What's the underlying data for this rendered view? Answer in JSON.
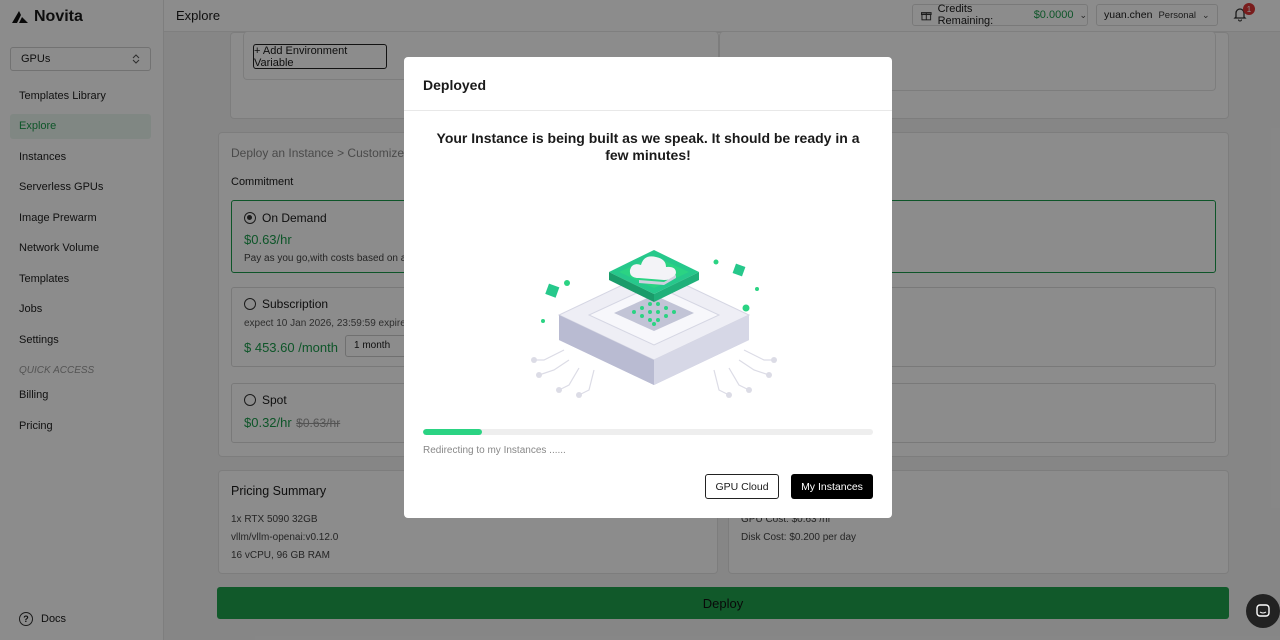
{
  "brand": {
    "name": "Novita"
  },
  "sidebar": {
    "gpu_select": "GPUs",
    "items": [
      {
        "label": "Templates Library"
      },
      {
        "label": "Explore",
        "active": true
      },
      {
        "label": "Instances"
      },
      {
        "label": "Serverless GPUs"
      },
      {
        "label": "Image Prewarm"
      },
      {
        "label": "Network Volume"
      },
      {
        "label": "Templates"
      },
      {
        "label": "Jobs"
      },
      {
        "label": "Settings"
      }
    ],
    "quick_access_label": "QUICK ACCESS",
    "quick_items": [
      {
        "label": "Billing"
      },
      {
        "label": "Pricing"
      }
    ],
    "docs_label": "Docs"
  },
  "header": {
    "title": "Explore",
    "credits_label": "Credits Remaining:",
    "credits_value": "$0.0000",
    "username": "yuan.chen",
    "plan": "Personal",
    "notification_count": "1"
  },
  "main": {
    "env_button": "+ Add Environment Variable",
    "breadcrumb": "Deploy an Instance > Customize",
    "commitment_label": "Commitment",
    "options": [
      {
        "title": "On Demand",
        "price": "$0.63/hr",
        "desc": "Pay as you go,with costs based on act"
      },
      {
        "title": "Subscription",
        "expire": "expect  10 Jan 2026, 23:59:59 expire",
        "price": "$ 453.60 /month",
        "duration": "1 month"
      },
      {
        "title": "Spot",
        "price": "$0.32/hr",
        "old_price": "$0.63/hr"
      }
    ],
    "pricing_summary": {
      "title": "Pricing Summary",
      "lines": [
        "1x RTX 5090 32GB",
        "vllm/vllm-openai:v0.12.0",
        "16 vCPU, 96 GB RAM"
      ],
      "gpu_cost": "GPU Cost: $0.63 /hr",
      "disk_cost": "Disk Cost: $0.200 per day"
    },
    "deploy_label": "Deploy"
  },
  "modal": {
    "title": "Deployed",
    "message": "Your Instance is being built as we speak. It should be ready in a few minutes!",
    "progress": 0.13,
    "redirect_text": "Redirecting to my Instances ......",
    "gpu_cloud_label": "GPU Cloud",
    "my_instances_label": "My Instances"
  },
  "colors": {
    "accent": "#1fa34e",
    "progress": "#2bd383"
  },
  "icons": [
    "logo-icon",
    "select-arrows-icon",
    "gift-icon",
    "chevron-down-icon",
    "bell-icon",
    "help-icon",
    "chat-icon",
    "deploy-illustration"
  ]
}
